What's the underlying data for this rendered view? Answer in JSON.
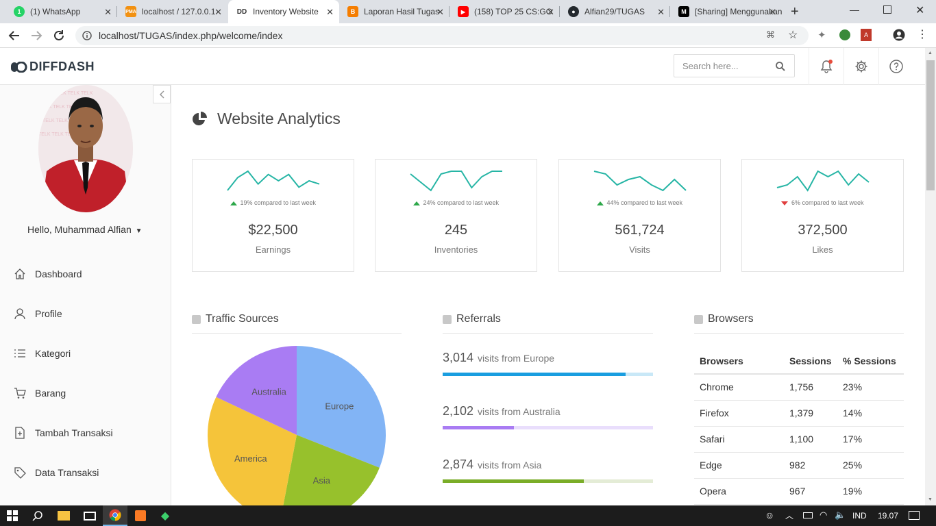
{
  "browser": {
    "tabs": [
      {
        "title": "(1) WhatsApp",
        "favicon": "whatsapp-icon",
        "color": "#25d366"
      },
      {
        "title": "localhost / 127.0.0.1",
        "favicon": "phpmyadmin-icon",
        "color": "#f29111"
      },
      {
        "title": "Inventory Website",
        "favicon": "diffdash-icon",
        "color": "#333333"
      },
      {
        "title": "Laporan Hasil Tugas",
        "favicon": "blogger-icon",
        "color": "#f57d00"
      },
      {
        "title": "(158) TOP 25 CS:GO",
        "favicon": "youtube-icon",
        "color": "#ff0000"
      },
      {
        "title": "Alfian29/TUGAS",
        "favicon": "github-icon",
        "color": "#24292e"
      },
      {
        "title": "[Sharing] Menggunakan",
        "favicon": "medium-icon",
        "color": "#000000"
      }
    ],
    "url": "localhost/TUGAS/index.php/welcome/index"
  },
  "header": {
    "logo": "DIFFDASH",
    "search_placeholder": "Search here..."
  },
  "sidebar": {
    "hello": "Hello, Muhammad Alfian",
    "items": [
      {
        "label": "Dashboard",
        "icon": "home-icon"
      },
      {
        "label": "Profile",
        "icon": "user-icon"
      },
      {
        "label": "Kategori",
        "icon": "list-icon"
      },
      {
        "label": "Barang",
        "icon": "cart-icon"
      },
      {
        "label": "Tambah Transaksi",
        "icon": "add-document-icon"
      },
      {
        "label": "Data Transaksi",
        "icon": "tag-icon"
      }
    ]
  },
  "main": {
    "title": "Website Analytics",
    "cards": [
      {
        "compare": "19% compared to last week",
        "trend": "up",
        "value": "$22,500",
        "label": "Earnings",
        "spark": [
          5,
          9,
          11,
          7,
          10,
          8,
          10,
          6,
          8,
          7
        ]
      },
      {
        "compare": "24% compared to last week",
        "trend": "up",
        "value": "245",
        "label": "Inventories",
        "spark": [
          9,
          6,
          3,
          9,
          10,
          10,
          4,
          8,
          10,
          10
        ]
      },
      {
        "compare": "44% compared to last week",
        "trend": "up",
        "value": "561,724",
        "label": "Visits",
        "spark": [
          10,
          9,
          5,
          7,
          8,
          5,
          3,
          7,
          3
        ]
      },
      {
        "compare": "6% compared to last week",
        "trend": "down",
        "value": "372,500",
        "label": "Likes",
        "spark": [
          4,
          5,
          8,
          3,
          10,
          8,
          10,
          5,
          9,
          6
        ]
      }
    ],
    "traffic": {
      "title": "Traffic Sources",
      "chart_data": {
        "type": "pie",
        "categories": [
          "Europe",
          "Asia",
          "America",
          "Australia"
        ],
        "values": [
          31,
          22,
          29,
          18
        ],
        "colors": [
          "#82b4f5",
          "#97c12c",
          "#f5c43a",
          "#a97cf3"
        ]
      }
    },
    "referrals": {
      "title": "Referrals",
      "items": [
        {
          "value": "3,014",
          "text": "visits from Europe",
          "fraction": 0.87,
          "color": "#1a9ee0",
          "track": "#c9e8f7"
        },
        {
          "value": "2,102",
          "text": "visits from Australia",
          "fraction": 0.34,
          "color": "#a97cf3",
          "track": "#e9defc"
        },
        {
          "value": "2,874",
          "text": "visits from Asia",
          "fraction": 0.67,
          "color": "#7aad28",
          "track": "#e4ecd6"
        }
      ]
    },
    "browsers": {
      "title": "Browsers",
      "columns": [
        "Browsers",
        "Sessions",
        "% Sessions"
      ],
      "rows": [
        [
          "Chrome",
          "1,756",
          "23%"
        ],
        [
          "Firefox",
          "1,379",
          "14%"
        ],
        [
          "Safari",
          "1,100",
          "17%"
        ],
        [
          "Edge",
          "982",
          "25%"
        ],
        [
          "Opera",
          "967",
          "19%"
        ]
      ]
    }
  },
  "taskbar": {
    "lang": "IND",
    "time": "19.07"
  }
}
